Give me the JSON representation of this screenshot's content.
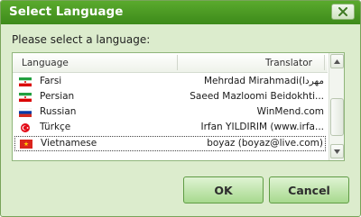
{
  "window": {
    "title": "Select Language",
    "close_icon": "close-icon"
  },
  "prompt": "Please select a language:",
  "list": {
    "columns": {
      "language": "Language",
      "translator": "Translator"
    },
    "rows": [
      {
        "language": "Farsi",
        "translator": "Mehrdad Mirahmadi(مهردا",
        "flag": "iran-flag-icon"
      },
      {
        "language": "Persian",
        "translator": "Saeed Mazloomi Beidokhti...",
        "flag": "iran-flag-icon"
      },
      {
        "language": "Russian",
        "translator": "WinMend.com",
        "flag": "russia-flag-icon"
      },
      {
        "language": "Türkçe",
        "translator": "İrfan YILDIRIM (www.irfa...",
        "flag": "turkey-flag-icon"
      },
      {
        "language": "Vietnamese",
        "translator": "boyaz (boyaz@live.com)",
        "flag": "vietnam-flag-icon",
        "selected": true
      }
    ]
  },
  "buttons": {
    "ok": "OK",
    "cancel": "Cancel"
  },
  "colors": {
    "titlebar": "#4a9a24",
    "dialog_bg": "#dceccd",
    "button": "#a7d98e"
  }
}
